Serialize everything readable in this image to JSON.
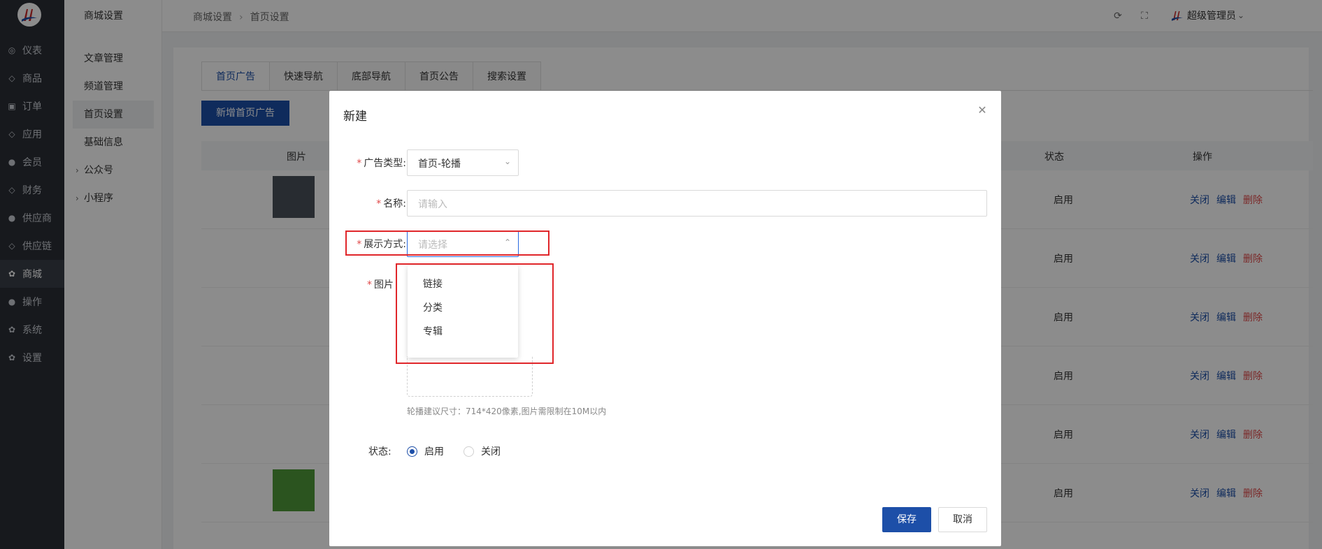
{
  "sidebar": {
    "items": [
      {
        "label": "仪表",
        "icon": "gauge-icon"
      },
      {
        "label": "商品",
        "icon": "bag-icon"
      },
      {
        "label": "订单",
        "icon": "order-icon"
      },
      {
        "label": "应用",
        "icon": "app-icon"
      },
      {
        "label": "会员",
        "icon": "user-icon"
      },
      {
        "label": "财务",
        "icon": "finance-icon"
      },
      {
        "label": "供应商",
        "icon": "supplier-icon"
      },
      {
        "label": "供应链",
        "icon": "chain-icon"
      },
      {
        "label": "商城",
        "icon": "gear-icon",
        "active": true
      },
      {
        "label": "操作",
        "icon": "user-icon"
      },
      {
        "label": "系统",
        "icon": "gear-icon"
      },
      {
        "label": "设置",
        "icon": "gear-icon"
      }
    ]
  },
  "submenu": {
    "title": "商城设置",
    "items": [
      {
        "label": "文章管理"
      },
      {
        "label": "频道管理"
      },
      {
        "label": "首页设置",
        "active": true
      },
      {
        "label": "基础信息"
      },
      {
        "label": "公众号",
        "expandable": true
      },
      {
        "label": "小程序",
        "expandable": true
      }
    ]
  },
  "header": {
    "breadcrumb": [
      "商城设置",
      "首页设置"
    ],
    "user": "超级管理员"
  },
  "tabs": [
    "首页广告",
    "快速导航",
    "底部导航",
    "首页公告",
    "搜索设置"
  ],
  "add_button": "新增首页广告",
  "table": {
    "columns": {
      "image": "图片",
      "status": "状态",
      "actions": "操作"
    },
    "rows": [
      {
        "status": "启用"
      },
      {
        "status": "启用"
      },
      {
        "status": "启用"
      },
      {
        "status": "启用"
      },
      {
        "status": "启用"
      },
      {
        "status": "启用"
      }
    ],
    "actions": {
      "close": "关闭",
      "edit": "编辑",
      "delete": "删除"
    }
  },
  "modal": {
    "title": "新建",
    "fields": {
      "ad_type": {
        "label": "广告类型:",
        "value": "首页-轮播"
      },
      "name": {
        "label": "名称:",
        "placeholder": "请输入"
      },
      "display_mode": {
        "label": "展示方式:",
        "placeholder": "请选择"
      },
      "image": {
        "label": "图片"
      },
      "status": {
        "label": "状态:",
        "options": [
          "启用",
          "关闭"
        ],
        "selected": "启用"
      }
    },
    "dropdown_options": [
      "链接",
      "分类",
      "专辑"
    ],
    "image_hint": "轮播建议尺寸：714*420像素,图片需限制在10M以内",
    "save": "保存",
    "cancel": "取消"
  }
}
